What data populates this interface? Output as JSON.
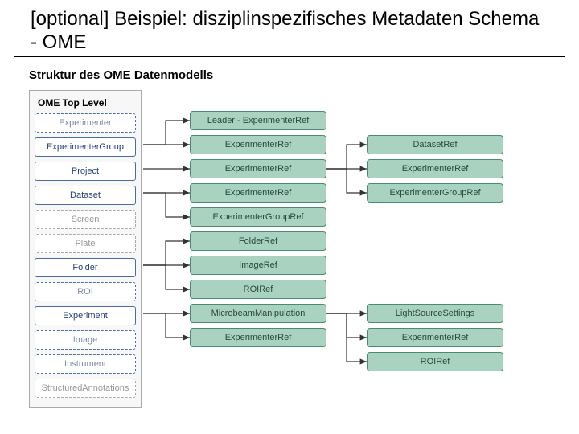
{
  "title": "[optional] Beispiel: disziplinspezifisches Metadaten Schema - OME",
  "subtitle": "Struktur des OME Datenmodells",
  "panel_title": "OME Top Level",
  "col1": {
    "experimenter": "Experimenter",
    "experimenter_group": "ExperimenterGroup",
    "project": "Project",
    "dataset": "Dataset",
    "screen": "Screen",
    "plate": "Plate",
    "folder": "Folder",
    "roi": "ROI",
    "experiment": "Experiment",
    "image": "Image",
    "instrument": "Instrument",
    "structured_annotations": "StructuredAnnotations"
  },
  "col2": {
    "leader_exp_ref": "Leader - ExperimenterRef",
    "experimenter_ref_1": "ExperimenterRef",
    "experimenter_ref_2": "ExperimenterRef",
    "experimenter_ref_3": "ExperimenterRef",
    "experimenter_group_ref": "ExperimenterGroupRef",
    "folder_ref": "FolderRef",
    "image_ref": "ImageRef",
    "roi_ref": "ROIRef",
    "microbeam_manipulation": "MicrobeamManipulation",
    "experimenter_ref_4": "ExperimenterRef"
  },
  "col3": {
    "dataset_ref": "DatasetRef",
    "experimenter_ref": "ExperimenterRef",
    "experimenter_group_ref": "ExperimenterGroupRef",
    "light_source_settings": "LightSourceSettings",
    "experimenter_ref_2": "ExperimenterRef",
    "roi_ref": "ROIRef"
  }
}
